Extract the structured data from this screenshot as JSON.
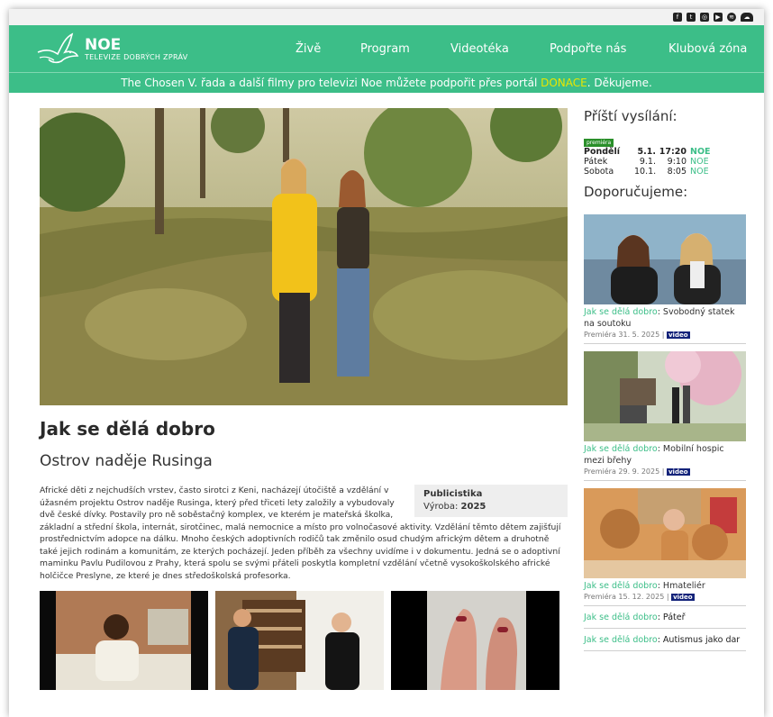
{
  "social_icons": [
    "facebook-icon",
    "twitter-icon",
    "instagram-icon",
    "youtube-icon",
    "spotify-icon",
    "soundcloud-icon"
  ],
  "brand": {
    "name": "NOE",
    "tagline": "TELEVIZE DOBRÝCH ZPRÁV",
    "color": "#3cbe88"
  },
  "menu": [
    {
      "label": "Živě"
    },
    {
      "label": "Program"
    },
    {
      "label": "Videotéka"
    },
    {
      "label": "Podpořte nás"
    },
    {
      "label": "Klubová zóna"
    }
  ],
  "banner": {
    "pre": "The Chosen V. řada a další filmy pro televizi Noe můžete podpořit přes portál ",
    "link": "DONACE",
    "post": ". Děkujeme."
  },
  "article": {
    "title": "Jak se dělá dobro",
    "subtitle": "Ostrov naděje Rusinga",
    "genre": "Publicistika",
    "year_label": "Výroba:",
    "year": "2025",
    "body": "Africké děti z nejchudších vrstev, často sirotci z Keni, nacházejí útočiště a vzdělání v úžasném projektu Ostrov naděje Rusinga, který před třiceti lety založily a vybudovaly dvě české dívky. Postavily pro ně soběstačný komplex, ve kterém je mateřská školka, základní a střední škola, internát, sirotčinec, malá nemocnice a místo pro volnočasové aktivity. Vzdělání těmto dětem zajišťují prostřednictvím adopce na dálku. Mnoho českých adoptivních rodičů tak změnilo osud chudým africkým dětem a druhotně také jejich rodinám a komunitám, ze kterých pocházejí. Jeden příběh za všechny uvidíme i v dokumentu. Jedná se o adoptivní maminku Pavlu Pudilovou z Prahy, která spolu se svými přáteli poskytla kompletní vzdělání včetně vysokoškolského africké holčičce Preslyne, ze které je dnes středoškolská profesorka."
  },
  "sidebar": {
    "next_title": "Příští vysílání:",
    "premiere_badge": "premiéra",
    "schedule": [
      {
        "day": "Pondělí",
        "date": "5.1.",
        "time": "17:20",
        "channel": "NOE",
        "bold": true
      },
      {
        "day": "Pátek",
        "date": "9.1.",
        "time": "9:10",
        "channel": "NOE",
        "bold": false
      },
      {
        "day": "Sobota",
        "date": "10.1.",
        "time": "8:05",
        "channel": "NOE",
        "bold": false
      }
    ],
    "recommend_title": "Doporučujeme:",
    "recommendations": [
      {
        "series": "Jak se dělá dobro",
        "title": ": Svobodný statek na soutoku",
        "meta": "Premiéra 31. 5. 2025 | ",
        "badge": "video"
      },
      {
        "series": "Jak se dělá dobro",
        "title": ": Mobilní hospic mezi břehy",
        "meta": "Premiéra 29. 9. 2025 | ",
        "badge": "video"
      },
      {
        "series": "Jak se dělá dobro",
        "title": ": Hmateliér",
        "meta": "Premiéra 15. 12. 2025 | ",
        "badge": "video"
      }
    ],
    "text_links": [
      {
        "series": "Jak se dělá dobro",
        "title": ": Páteř"
      },
      {
        "series": "Jak se dělá dobro",
        "title": ": Autismus jako dar"
      }
    ]
  }
}
